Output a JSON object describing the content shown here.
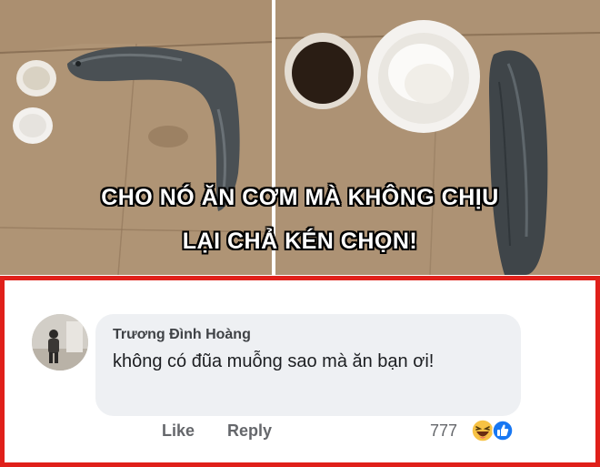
{
  "meme": {
    "caption_line1": "CHO NÓ ĂN CƠM MÀ KHÔNG CHỊU",
    "caption_line2": "LẠI CHẢ KÉN CHỌN!"
  },
  "comment": {
    "author": "Trương Đình Hoàng",
    "text": "không có đũa muỗng sao mà ăn bạn ơi!",
    "actions": {
      "like": "Like",
      "reply": "Reply"
    },
    "reaction_count": "777",
    "reaction_icons": [
      "haha-icon",
      "like-icon"
    ]
  },
  "colors": {
    "frame_border": "#e0201a",
    "bubble_bg": "#eef0f3",
    "like_blue": "#1877f2",
    "haha_yellow": "#f7c244"
  }
}
